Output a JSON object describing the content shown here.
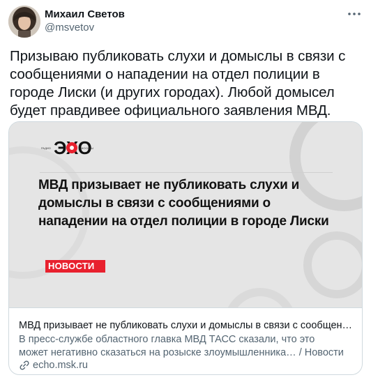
{
  "author": {
    "name": "Михаил Светов",
    "handle": "@msvetov"
  },
  "tweet": {
    "text": "Призываю публиковать слухи и домыслы в связи с сообщениями о нападении на отдел полиции в городе Лиски (и других городах). Любой домысел будет правдивее официального заявления МВД."
  },
  "card": {
    "image_headline": "МВД призывает не публиковать слухи и домыслы в связи с сообщениями о нападении на отдел полиции в городе Лиски",
    "logo_text_left": "РАДИО",
    "logo_text_main": "ЭХО",
    "logo_text_right": "МОСКВЫ",
    "badge": "НОВОСТИ",
    "title": "МВД призывает не публиковать слухи и домыслы в связи с сообщениями о ...",
    "description": "В пресс-службе областного главка МВД ТАСС сказали, что это может негативно сказаться на розыске злоумышленника… / Новости",
    "domain": "echo.msk.ru"
  },
  "colors": {
    "text_primary": "#0f1419",
    "text_secondary": "#536471",
    "border": "#cfd9de",
    "badge_red": "#e8212e"
  },
  "icons": {
    "more": "more-dots-icon",
    "link": "link-icon"
  }
}
